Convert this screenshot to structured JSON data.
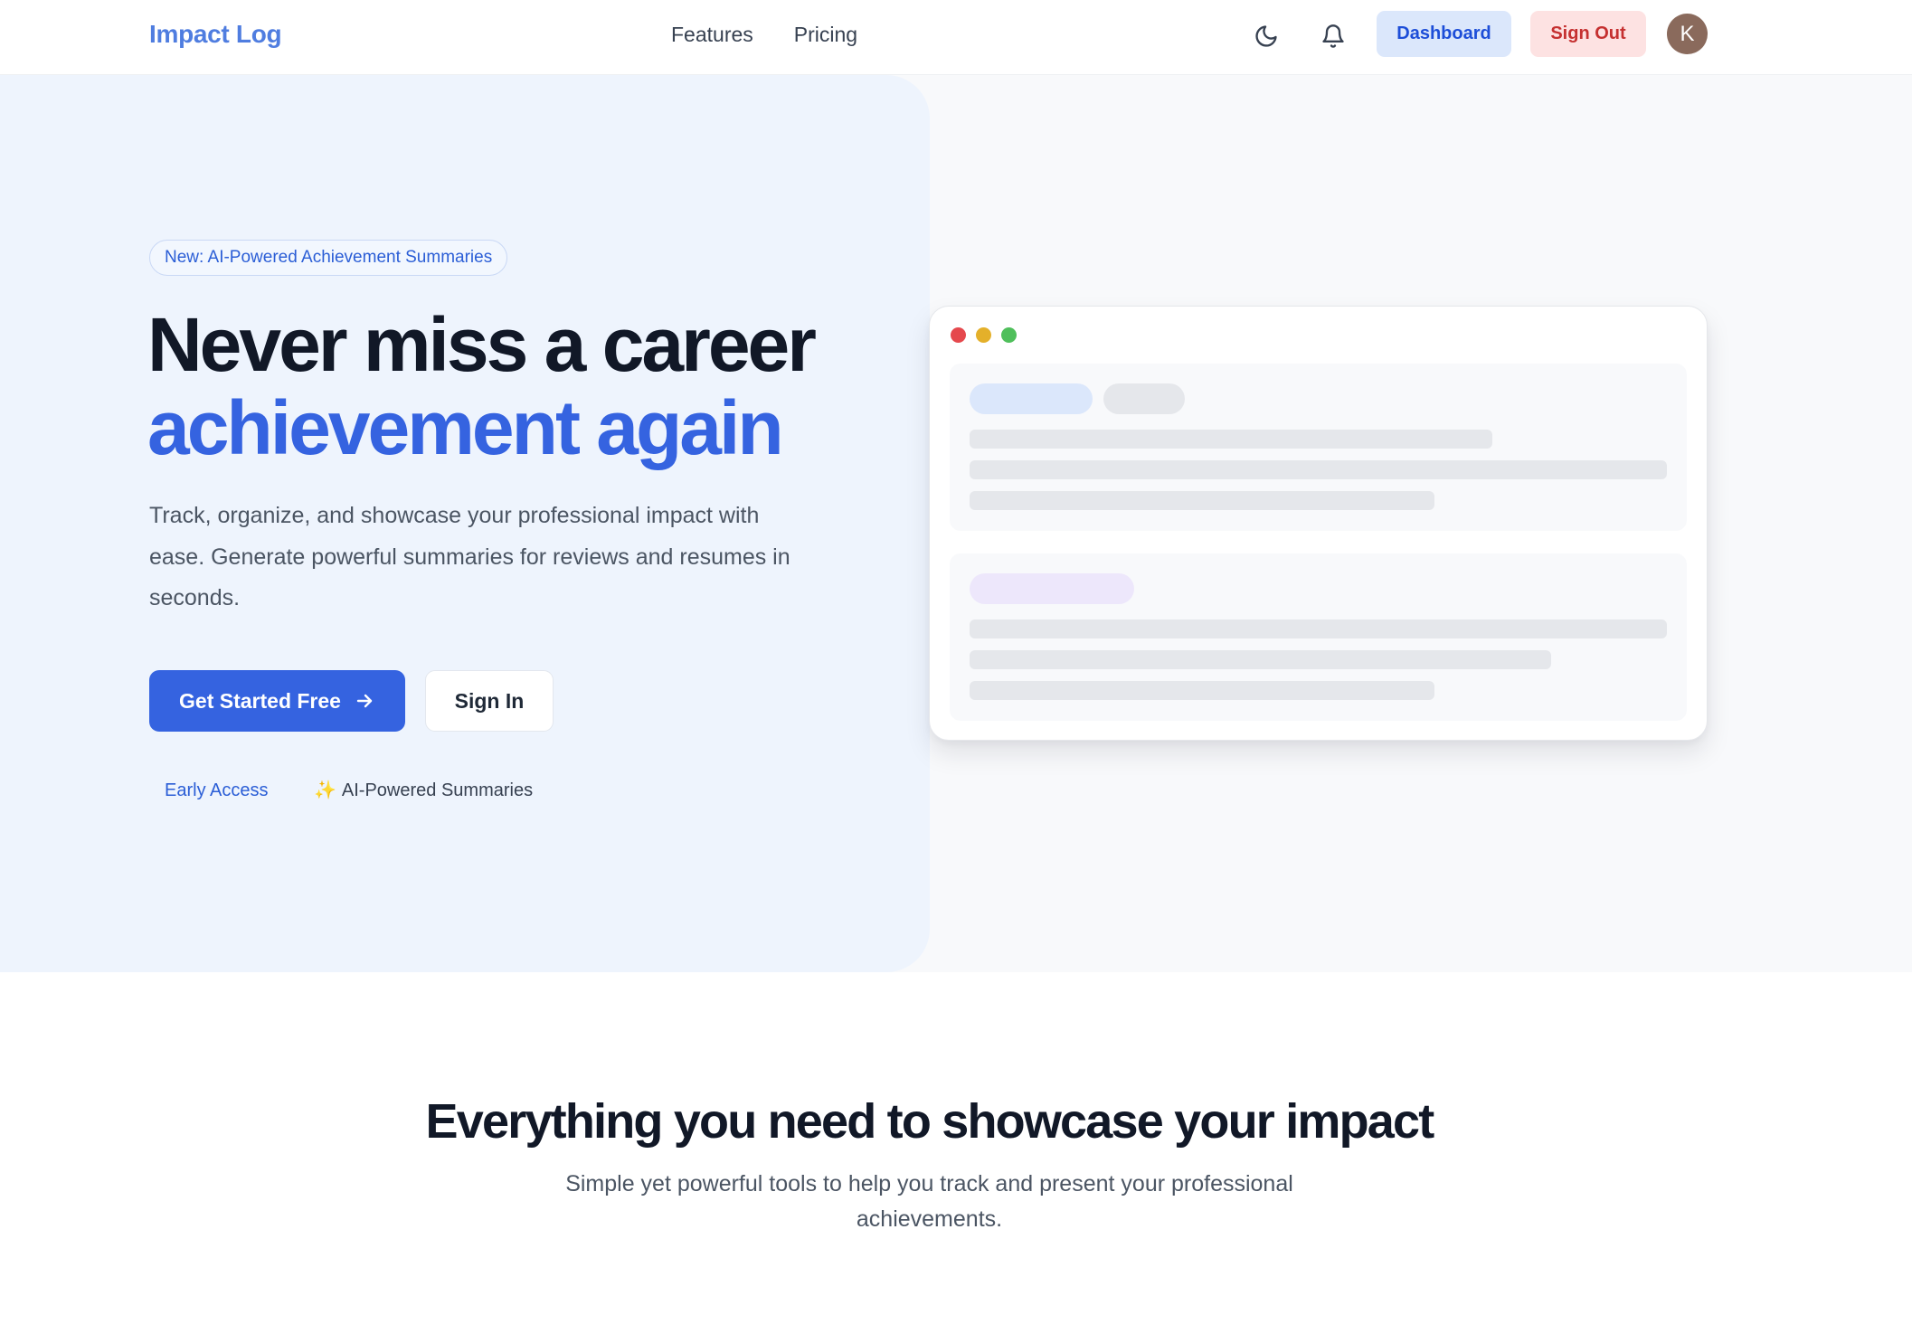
{
  "header": {
    "logo": "Impact Log",
    "nav": [
      "Features",
      "Pricing"
    ],
    "theme_icon": "moon-icon",
    "notifications_icon": "bell-icon",
    "dashboard_label": "Dashboard",
    "signout_label": "Sign Out",
    "avatar_initial": "K"
  },
  "hero": {
    "badge": "New: AI-Powered Achievement Summaries",
    "title_line1": "Never miss a career",
    "title_line2": "achievement again",
    "subtitle": "Track, organize, and showcase your professional impact with ease. Generate powerful summaries for reviews and resumes in seconds.",
    "primary_cta": "Get Started Free",
    "secondary_cta": "Sign In",
    "tag_early": "Early Access",
    "tag_ai_icon": "✨",
    "tag_ai": "AI-Powered Summaries"
  },
  "features": {
    "title": "Everything you need to showcase your impact",
    "subtitle": "Simple yet powerful tools to help you track and present your professional achievements."
  },
  "colors": {
    "brand": "#3563e0",
    "logo": "#4f7de0",
    "hero_bg": "#eef4fd",
    "danger": "#c53030"
  }
}
